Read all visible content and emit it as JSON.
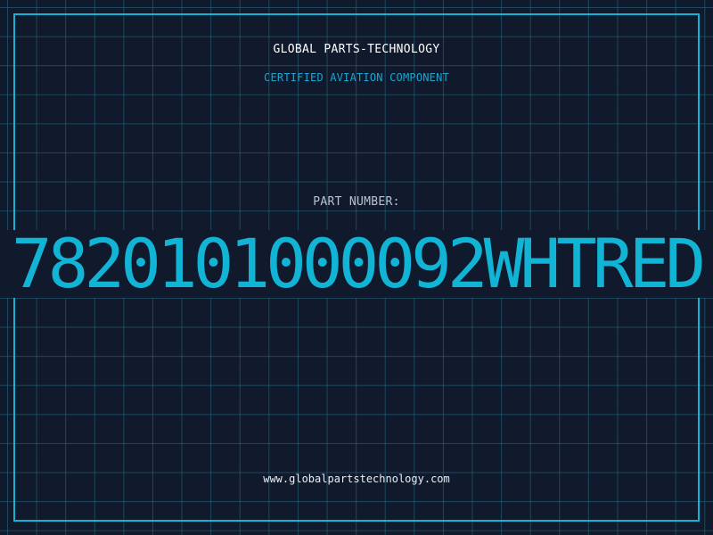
{
  "header": {
    "company": "GLOBAL PARTS-TECHNOLOGY",
    "tagline": "CERTIFIED AVIATION COMPONENT"
  },
  "part": {
    "label": "PART NUMBER:",
    "value": "7820101000092WHTRED"
  },
  "footer": {
    "url": "www.globalpartstechnology.com"
  },
  "colors": {
    "background": "#101a2c",
    "accent": "#12b4d6",
    "grid": "#286e82"
  }
}
